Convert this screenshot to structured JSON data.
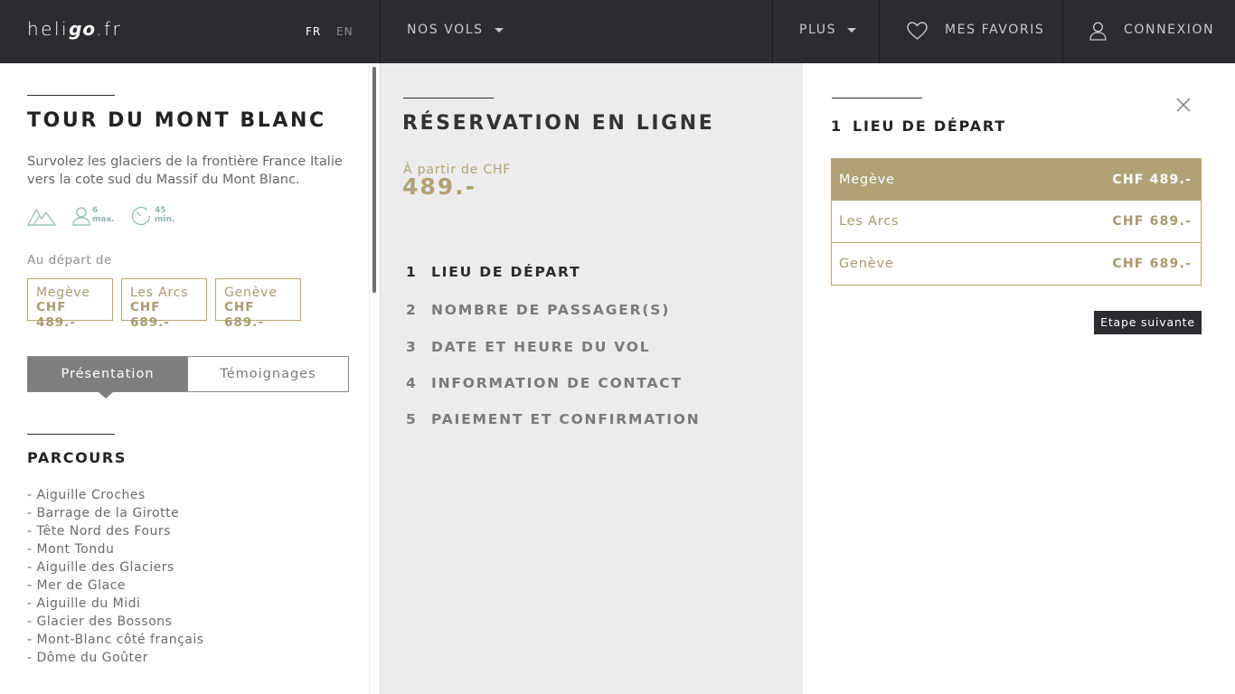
{
  "header": {
    "logo": {
      "prefix": "heli",
      "bold": "go",
      "suffix": ".fr"
    },
    "lang_fr": "FR",
    "lang_en": "EN",
    "nav_flights": "NOS VOLS",
    "nav_more": "PLUS",
    "favorites": "MES FAVORIS",
    "login": "CONNEXION"
  },
  "tour": {
    "title": "TOUR DU MONT BLANC",
    "description": "Survolez les glaciers de la frontière France Italie vers la cote sud du Massif du Mont Blanc.",
    "specs": {
      "passengers_num": "6",
      "passengers_unit": "max.",
      "duration_num": "45",
      "duration_unit": "min."
    },
    "depart_label": "Au départ de",
    "departures": [
      {
        "name": "Megève",
        "price": "CHF 489.-"
      },
      {
        "name": "Les Arcs",
        "price": "CHF 689.-"
      },
      {
        "name": "Genève",
        "price": "CHF 689.-"
      }
    ],
    "tabs": {
      "presentation": "Présentation",
      "testimonials": "Témoignages"
    },
    "section_title": "PARCOURS",
    "route": [
      "- Aiguille Croches",
      "- Barrage de la Girotte",
      "- Tête Nord des Fours",
      "- Mont Tondu",
      "- Aiguille des Glaciers",
      "- Mer de Glace",
      "- Aiguille du Midi",
      "- Glacier des Bossons",
      "- Mont-Blanc côté français",
      "- Dôme du Goûter"
    ]
  },
  "booking": {
    "title": "RÉSERVATION EN LIGNE",
    "from_label": "À partir de CHF",
    "from_price": "489.-",
    "steps": [
      {
        "num": "1",
        "label": "LIEU DE DÉPART"
      },
      {
        "num": "2",
        "label": "NOMBRE DE PASSAGER(S)"
      },
      {
        "num": "3",
        "label": "DATE ET HEURE DU VOL"
      },
      {
        "num": "4",
        "label": "INFORMATION DE CONTACT"
      },
      {
        "num": "5",
        "label": "PAIEMENT ET CONFIRMATION"
      }
    ]
  },
  "step_panel": {
    "num": "1",
    "title": "LIEU DE DÉPART",
    "options": [
      {
        "name": "Megève",
        "price": "CHF 489.-"
      },
      {
        "name": "Les Arcs",
        "price": "CHF 689.-"
      },
      {
        "name": "Genève",
        "price": "CHF 689.-"
      }
    ],
    "selected_option": "Megève",
    "next_button": "Etape suivante"
  },
  "colors": {
    "header_bg": "#2b2c30",
    "gold": "#b0a276",
    "mid_bg": "#ececec",
    "spec_teal": "#8ab7b0"
  },
  "icons": [
    "heart-icon",
    "user-icon",
    "mountain-icon",
    "person-icon",
    "timer-icon",
    "close-icon",
    "chevron-down-icon"
  ]
}
